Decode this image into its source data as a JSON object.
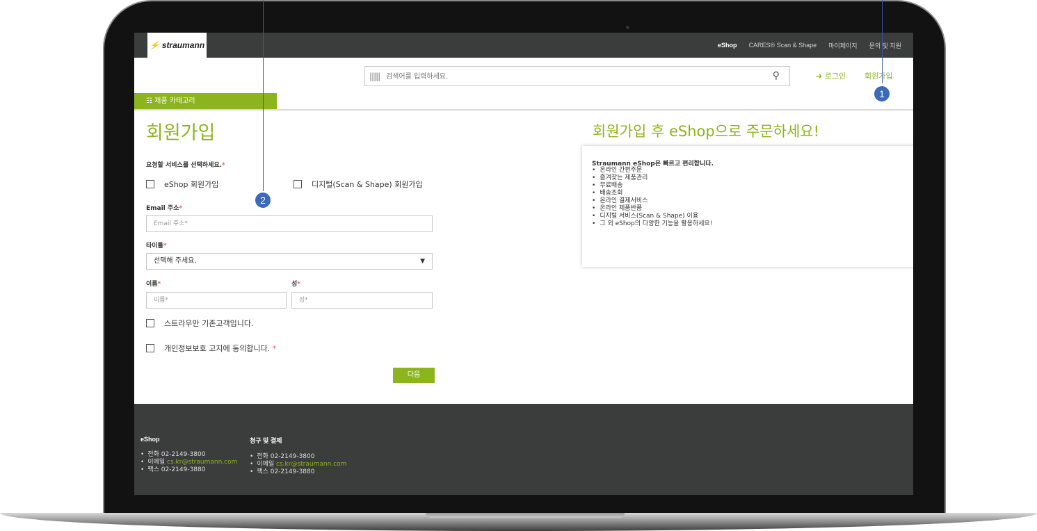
{
  "topbar": {
    "logo": "straumann",
    "nav": [
      "eShop",
      "CARES® Scan & Shape",
      "마이페이지",
      "문의 및 지원"
    ]
  },
  "header": {
    "search_placeholder": "검색어를 입력하세요.",
    "login": "로그인",
    "signup": "회원가입",
    "category_button": "제품 카테고리"
  },
  "form": {
    "title": "회원가입",
    "service_label": "요청할 서비스를 선택하세요.",
    "option_eshop": "eShop 회원가입",
    "option_digital": "디지털(Scan & Shape) 회원가입",
    "email_label": "Email 주소",
    "email_placeholder": "Email 주소*",
    "title_label": "타이틀",
    "title_select": "선택해 주세요.",
    "first_name_label": "이름",
    "first_name_placeholder": "이름*",
    "last_name_label": "성",
    "last_name_placeholder": "성*",
    "existing_customer": "스트라우만 기존고객입니다.",
    "privacy": "개인정보보호 고지에 동의합니다.",
    "next": "다음",
    "required_mark": "*"
  },
  "promo": {
    "heading": "회원가입 후 eShop으로 주문하세요!",
    "box_title": "Straumann eShop은 빠르고 편리합니다.",
    "items": [
      "온라인 간편주문",
      "즐겨찾는 제품관리",
      "무료배송",
      "배송조회",
      "온라인 결제서비스",
      "온라인 제품반품",
      "디지털 서비스(Scan & Shape) 이용",
      "그 외 eShop의 다양한 기능을 활용하세요!"
    ]
  },
  "footer": {
    "col1": {
      "title": "eShop",
      "phone": "전화 02-2149-3800",
      "email_label": "이메일",
      "email": "cs.kr@straumann.com",
      "fax": "팩스 02-2149-3880"
    },
    "col2": {
      "title": "청구 및 결제",
      "phone": "전화 02-2149-3800",
      "email_label": "이메일",
      "email": "cs.kr@straumann.com",
      "fax": "팩스 02-2149-3880"
    }
  },
  "annotations": {
    "badge1": "1",
    "badge2": "2"
  },
  "colors": {
    "accent": "#8cb41e",
    "topbar": "#3b3d3c",
    "annotation": "#3a6ab8"
  }
}
